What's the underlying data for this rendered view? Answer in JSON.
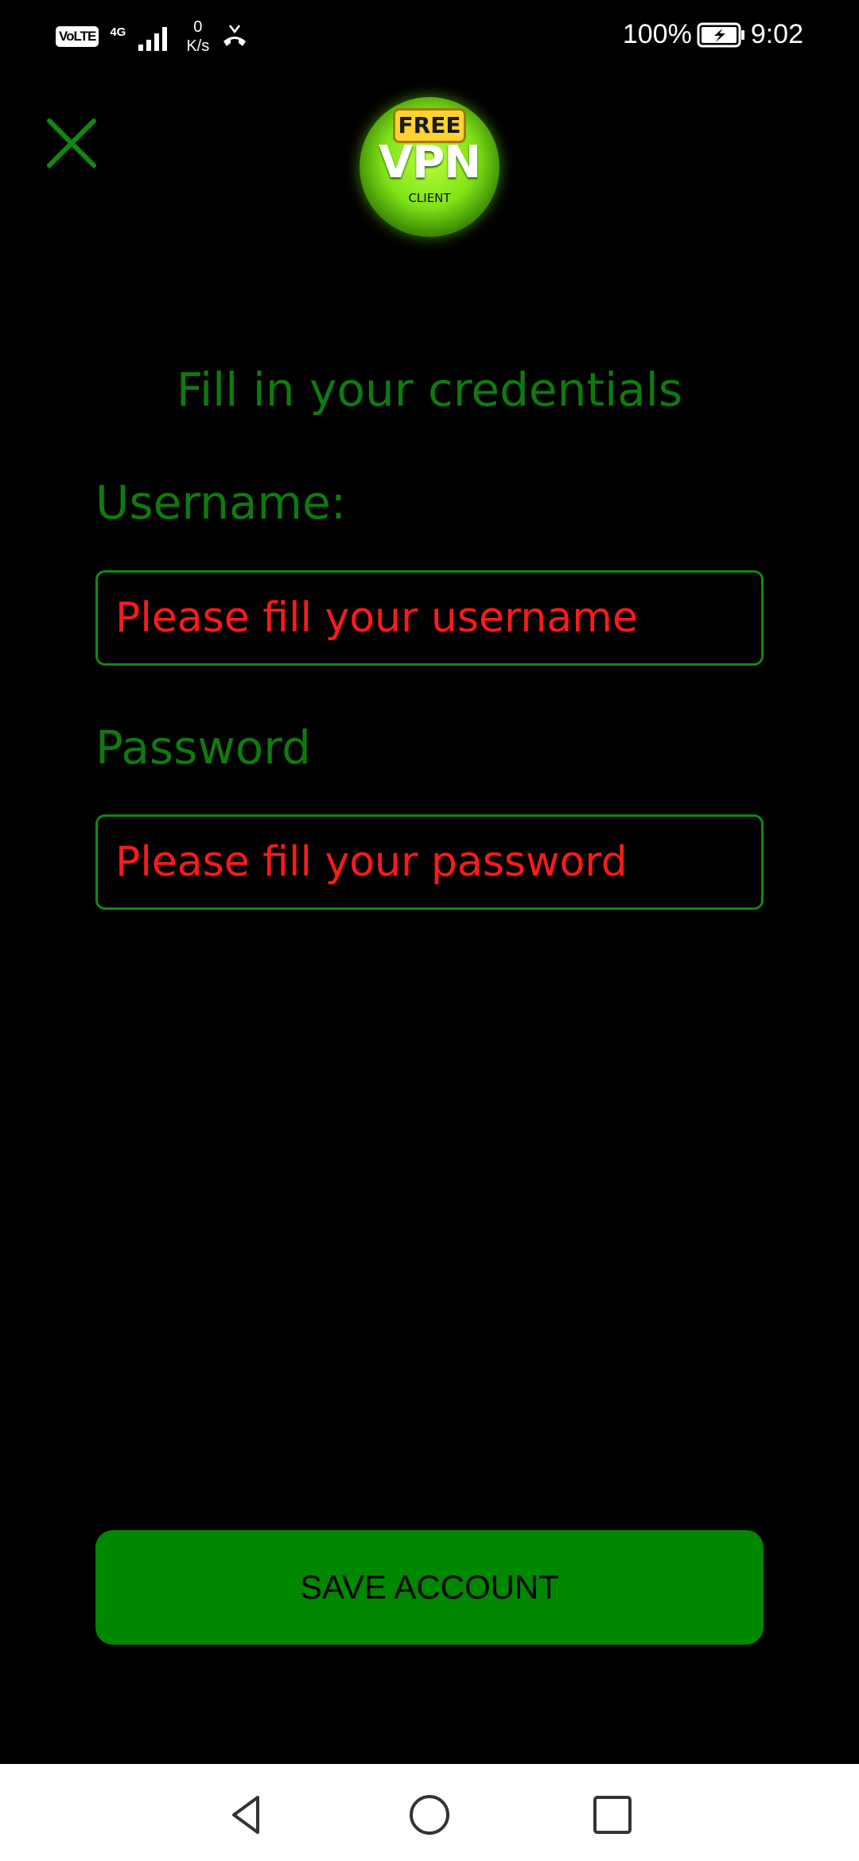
{
  "status_bar": {
    "volte": "VoLTE",
    "network_type": "4G",
    "speed_value": "0",
    "speed_unit": "K/s",
    "battery_percent": "100%",
    "time": "9:02"
  },
  "logo": {
    "badge": "FREE",
    "title": "VPN",
    "subtitle": "CLIENT"
  },
  "form": {
    "heading": "Fill in your credentials",
    "username_label": "Username:",
    "username_placeholder": "Please fill your username",
    "username_value": "",
    "password_label": "Password",
    "password_placeholder": "Please fill your password",
    "password_value": ""
  },
  "actions": {
    "save_label": "SAVE ACCOUNT"
  },
  "colors": {
    "background": "#000000",
    "accent_green": "#0f7a0f",
    "button_green": "#008800",
    "placeholder_red": "#ff1a1a"
  },
  "icons": {
    "close": "close-icon",
    "back": "back-icon",
    "home": "home-icon",
    "recent": "recent-apps-icon"
  }
}
